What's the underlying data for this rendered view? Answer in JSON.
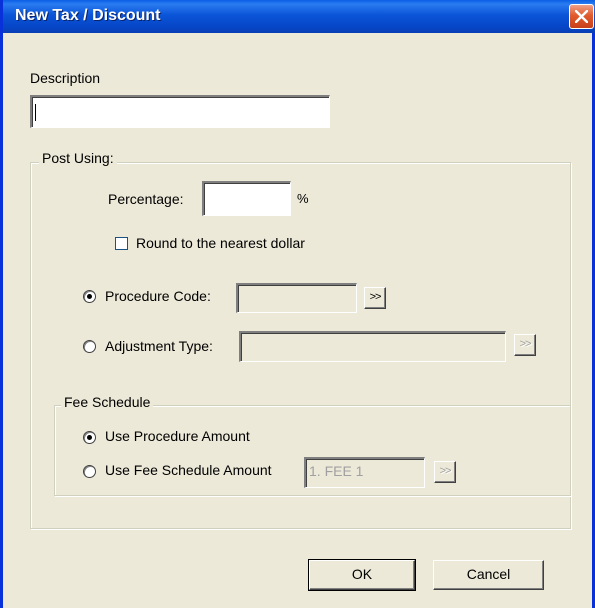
{
  "window": {
    "title": "New Tax / Discount"
  },
  "description": {
    "label": "Description",
    "value": ""
  },
  "post_using": {
    "legend": "Post Using:",
    "percentage_label": "Percentage:",
    "percentage_value": "",
    "percent_sign": "%",
    "round_label": "Round to the nearest dollar",
    "round_checked": false,
    "procedure_code_label": "Procedure Code:",
    "procedure_code_value": "",
    "procedure_code_selected": true,
    "adjustment_type_label": "Adjustment Type:",
    "adjustment_type_value": "",
    "adjustment_type_selected": false,
    "browse_label": ">>"
  },
  "fee_schedule": {
    "legend": "Fee Schedule",
    "use_procedure_label": "Use Procedure Amount",
    "use_procedure_selected": true,
    "use_fee_label": "Use Fee Schedule Amount",
    "use_fee_selected": false,
    "fee_value": "1. FEE 1",
    "browse_label": ">>"
  },
  "buttons": {
    "ok": "OK",
    "cancel": "Cancel"
  },
  "colors": {
    "title_bar": "#0b55d8",
    "window_bg": "#ece9d8",
    "close_button": "#e05a2d"
  }
}
